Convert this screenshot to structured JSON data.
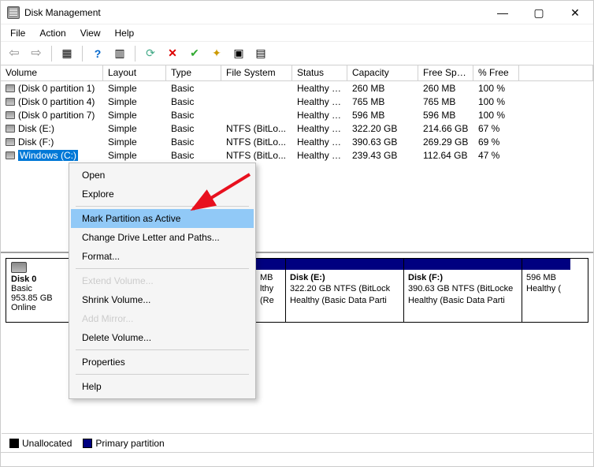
{
  "window": {
    "title": "Disk Management",
    "min_tooltip": "Minimize",
    "max_tooltip": "Maximize",
    "close_tooltip": "Close"
  },
  "menu": {
    "file": "File",
    "action": "Action",
    "view": "View",
    "help": "Help"
  },
  "columns": [
    "Volume",
    "Layout",
    "Type",
    "File System",
    "Status",
    "Capacity",
    "Free Spa...",
    "% Free"
  ],
  "rows": [
    {
      "volume": "(Disk 0 partition 1)",
      "layout": "Simple",
      "type": "Basic",
      "fs": "",
      "status": "Healthy (E...",
      "capacity": "260 MB",
      "free": "260 MB",
      "pct": "100 %",
      "selected": false
    },
    {
      "volume": "(Disk 0 partition 4)",
      "layout": "Simple",
      "type": "Basic",
      "fs": "",
      "status": "Healthy (R...",
      "capacity": "765 MB",
      "free": "765 MB",
      "pct": "100 %",
      "selected": false
    },
    {
      "volume": "(Disk 0 partition 7)",
      "layout": "Simple",
      "type": "Basic",
      "fs": "",
      "status": "Healthy (R...",
      "capacity": "596 MB",
      "free": "596 MB",
      "pct": "100 %",
      "selected": false
    },
    {
      "volume": "Disk (E:)",
      "layout": "Simple",
      "type": "Basic",
      "fs": "NTFS (BitLo...",
      "status": "Healthy (B...",
      "capacity": "322.20 GB",
      "free": "214.66 GB",
      "pct": "67 %",
      "selected": false
    },
    {
      "volume": "Disk (F:)",
      "layout": "Simple",
      "type": "Basic",
      "fs": "NTFS (BitLo...",
      "status": "Healthy (B...",
      "capacity": "390.63 GB",
      "free": "269.29 GB",
      "pct": "69 %",
      "selected": false
    },
    {
      "volume": "Windows (C:)",
      "layout": "Simple",
      "type": "Basic",
      "fs": "NTFS (BitLo...",
      "status": "Healthy (B...",
      "capacity": "239.43 GB",
      "free": "112.64 GB",
      "pct": "47 %",
      "selected": true
    }
  ],
  "disk": {
    "name": "Disk 0",
    "type": "Basic",
    "size": "953.85 GB",
    "status": "Online"
  },
  "partitions": [
    {
      "title": "",
      "line1": "MB",
      "line2": "lthy (Re",
      "width": 38
    },
    {
      "title": "Disk  (E:)",
      "line1": "322.20 GB NTFS (BitLock",
      "line2": "Healthy (Basic Data Parti",
      "width": 150
    },
    {
      "title": "Disk  (F:)",
      "line1": "390.63 GB NTFS (BitLocke",
      "line2": "Healthy (Basic Data Parti",
      "width": 150
    },
    {
      "title": "",
      "line1": "596 MB",
      "line2": "Healthy (",
      "width": 62
    }
  ],
  "context_menu": [
    {
      "label": "Open",
      "state": "enabled"
    },
    {
      "label": "Explore",
      "state": "enabled"
    },
    {
      "sep": true
    },
    {
      "label": "Mark Partition as Active",
      "state": "highlight"
    },
    {
      "label": "Change Drive Letter and Paths...",
      "state": "enabled"
    },
    {
      "label": "Format...",
      "state": "enabled"
    },
    {
      "sep": true
    },
    {
      "label": "Extend Volume...",
      "state": "disabled"
    },
    {
      "label": "Shrink Volume...",
      "state": "enabled"
    },
    {
      "label": "Add Mirror...",
      "state": "disabled"
    },
    {
      "label": "Delete Volume...",
      "state": "enabled"
    },
    {
      "sep": true
    },
    {
      "label": "Properties",
      "state": "enabled"
    },
    {
      "sep": true
    },
    {
      "label": "Help",
      "state": "enabled"
    }
  ],
  "legend": {
    "unallocated": "Unallocated",
    "primary": "Primary partition"
  },
  "colors": {
    "unallocated": "#000000",
    "primary": "#000080"
  }
}
